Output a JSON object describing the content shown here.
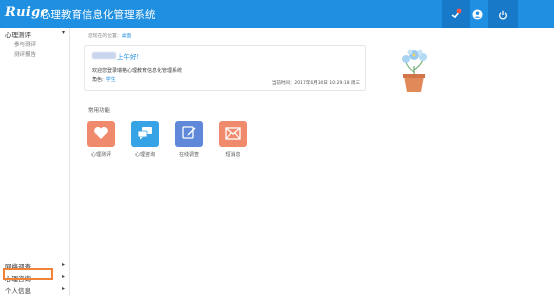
{
  "header": {
    "logo_text": "Ruige",
    "app_title": "心理教育信息化管理系统",
    "icons": [
      "notification-icon",
      "user-icon",
      "power-icon"
    ],
    "accent_color": "#1e8fe1"
  },
  "sidebar": {
    "section_top": {
      "label": "心理测评",
      "items": [
        "参与测评",
        "测评报告"
      ]
    },
    "bottom_items": [
      {
        "label": "网络调查"
      },
      {
        "label": "心理咨询"
      },
      {
        "label": "个人信息"
      }
    ],
    "highlighted": "心理咨询"
  },
  "breadcrumb": {
    "prefix": "您现在的位置：",
    "current": "桌面"
  },
  "welcome": {
    "greeting": "上午好!",
    "line1": "欢迎您登录瑞格心理教育信息化管理系统",
    "role_label": "角色:",
    "role_value": "学生",
    "time_label": "当前时间：",
    "time_value": "2017年6月30日 10:29:18 周三"
  },
  "functions": {
    "title": "常用功能",
    "items": [
      {
        "label": "心理测评",
        "icon": "heart-icon",
        "color": "#f08a6c"
      },
      {
        "label": "心理咨询",
        "icon": "chat-icon",
        "color": "#35a3e5"
      },
      {
        "label": "在线调查",
        "icon": "edit-icon",
        "color": "#5f88d8"
      },
      {
        "label": "短消息",
        "icon": "mail-icon",
        "color": "#f08a6c"
      }
    ]
  }
}
